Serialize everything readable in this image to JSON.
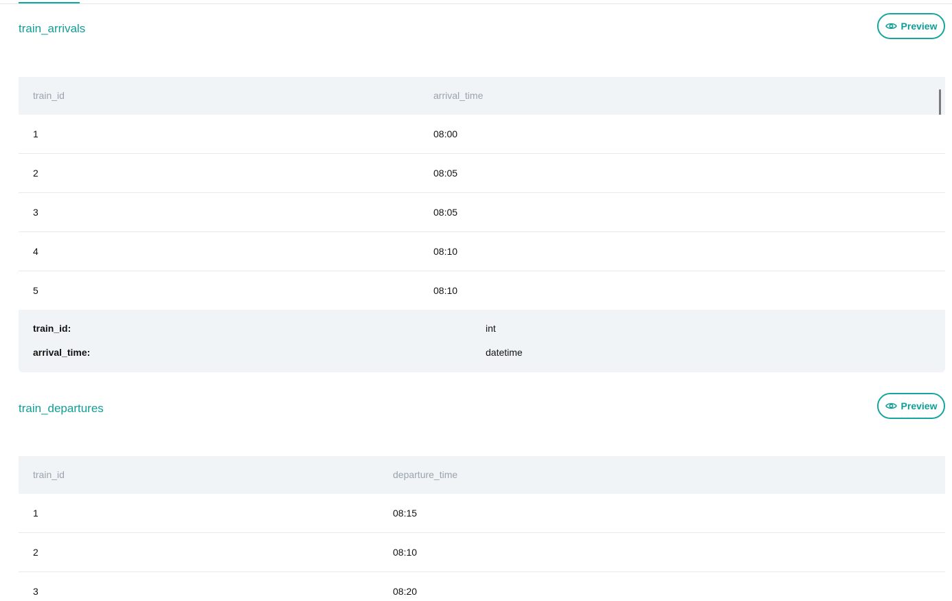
{
  "colors": {
    "accent": "#0f9e96",
    "header_bg": "#f1f4f7",
    "muted_text": "#9aa3ad"
  },
  "sections": [
    {
      "title": "train_arrivals",
      "preview_label": "Preview",
      "columns": [
        "train_id",
        "arrival_time"
      ],
      "rows": [
        [
          "1",
          "08:00"
        ],
        [
          "2",
          "08:05"
        ],
        [
          "3",
          "08:05"
        ],
        [
          "4",
          "08:10"
        ],
        [
          "5",
          "08:10"
        ]
      ],
      "schema": [
        {
          "name": "train_id:",
          "type": "int"
        },
        {
          "name": "arrival_time:",
          "type": "datetime"
        }
      ]
    },
    {
      "title": "train_departures",
      "preview_label": "Preview",
      "columns": [
        "train_id",
        "departure_time"
      ],
      "rows": [
        [
          "1",
          "08:15"
        ],
        [
          "2",
          "08:10"
        ],
        [
          "3",
          "08:20"
        ]
      ]
    }
  ],
  "icons": {
    "preview": "eye-icon"
  }
}
